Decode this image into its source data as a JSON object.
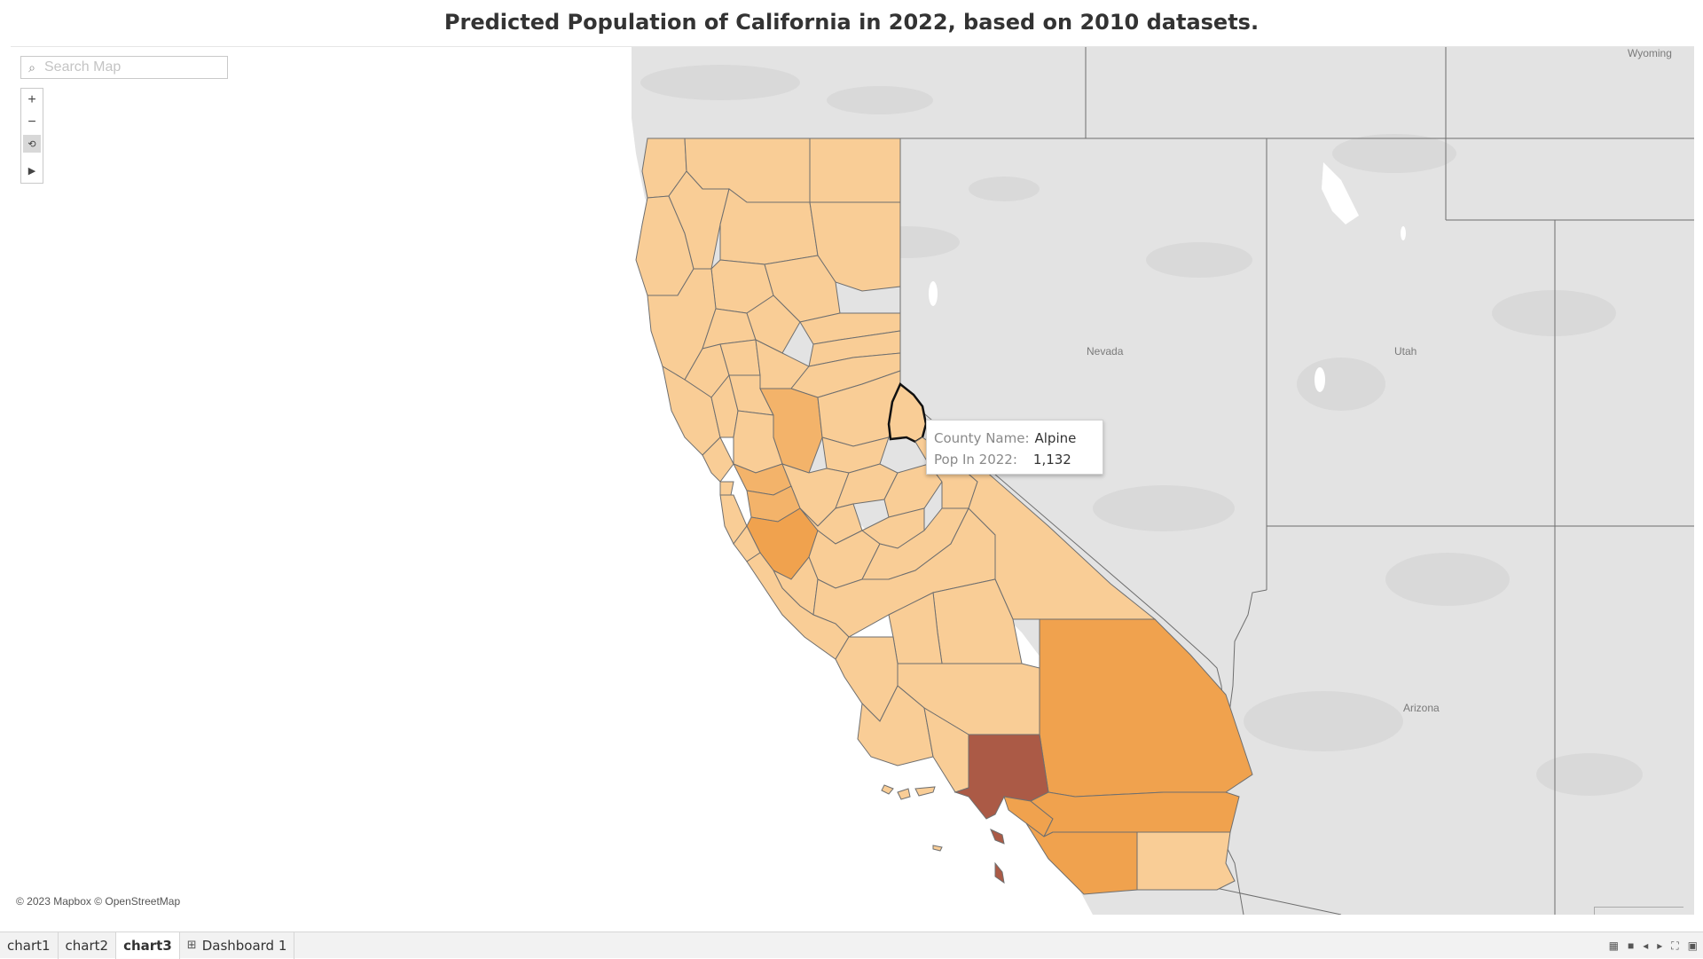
{
  "title": "Predicted Population of California  in 2022, based on 2010 datasets.",
  "search": {
    "placeholder": "Search Map"
  },
  "map_tools": [
    {
      "name": "zoom-in-button",
      "icon": "plus-icon",
      "glyph": "+"
    },
    {
      "name": "zoom-out-button",
      "icon": "minus-icon",
      "glyph": "−"
    },
    {
      "name": "reset-map-button",
      "icon": "reset-map-icon",
      "glyph": "⟲"
    },
    {
      "name": "expand-toolbar-button",
      "icon": "play-icon",
      "glyph": "▶"
    }
  ],
  "map_labels": {
    "nevada": "Nevada",
    "utah": "Utah",
    "arizona": "Arizona",
    "wyoming": "Wyoming"
  },
  "tooltip": {
    "county_label": "County Name:",
    "county_value": "Alpine",
    "pop_label": "Pop In 2022:",
    "pop_value": "1,132"
  },
  "attribution": "© 2023 Mapbox © OpenStreetMap",
  "colors": {
    "low": "#f9cd96",
    "mid": "#f3b36a",
    "high": "#f0a24e",
    "highest": "#ab5a46",
    "base_map": "#e6e6e6",
    "border": "#6f6f6f"
  },
  "tabs": [
    {
      "label": "chart1",
      "active": false
    },
    {
      "label": "chart2",
      "active": false
    },
    {
      "label": "chart3",
      "active": true
    },
    {
      "label": "Dashboard 1",
      "active": false,
      "icon": "dashboard-icon"
    }
  ],
  "status_icons": [
    "grid-icon",
    "list-icon",
    "prev-icon",
    "next-icon",
    "fullscreen-icon",
    "presentation-icon"
  ]
}
